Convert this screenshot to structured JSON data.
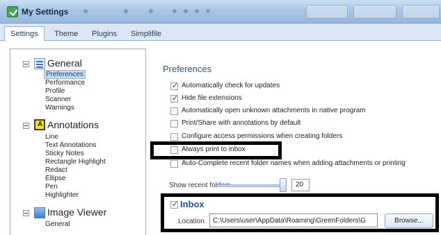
{
  "window": {
    "title": "My Settings"
  },
  "tabs": [
    {
      "label": "Settings"
    },
    {
      "label": "Theme"
    },
    {
      "label": "Plugins"
    },
    {
      "label": "Simplifile"
    }
  ],
  "tree": {
    "general": {
      "title": "General",
      "icon": "general-settings-icon",
      "items": [
        "Preferences",
        "Performance",
        "Profile",
        "Scanner",
        "Warnings"
      ]
    },
    "annotations": {
      "title": "Annotations",
      "icon": "annotations-icon",
      "items": [
        "Line",
        "Text Annotations",
        "Sticky Notes",
        "Rectangle Highlight",
        "Redact",
        "Ellipse",
        "Pen",
        "Highlighter"
      ]
    },
    "image_viewer": {
      "title": "Image Viewer",
      "icon": "image-viewer-icon",
      "items": [
        "General"
      ]
    }
  },
  "preferences": {
    "title": "Preferences",
    "options": [
      {
        "label": "Automatically check for updates",
        "checked": true
      },
      {
        "label": "Hide file extensions",
        "checked": true
      },
      {
        "label": "Automatically open unknown attachments in native program",
        "checked": false
      },
      {
        "label": "Print/Share with annotations by default",
        "checked": false
      },
      {
        "label": "Configure access permissions when creating folders",
        "checked": false
      },
      {
        "label": "Always print to inbox",
        "checked": false
      },
      {
        "label": "Auto-Complete recent folder names when adding attachments or printing",
        "checked": false
      }
    ],
    "recent_folders": {
      "label": "Show recent folders",
      "value": "20"
    }
  },
  "inbox": {
    "title": "Inbox",
    "checked": true,
    "location_label": "Location",
    "location_value": "C:\\Users\\user\\AppData\\Roaming\\GreenFolders\\G",
    "browse_label": "Browse..."
  },
  "colors": {
    "accent": "#2a4f86",
    "highlight_box": "#000000"
  }
}
